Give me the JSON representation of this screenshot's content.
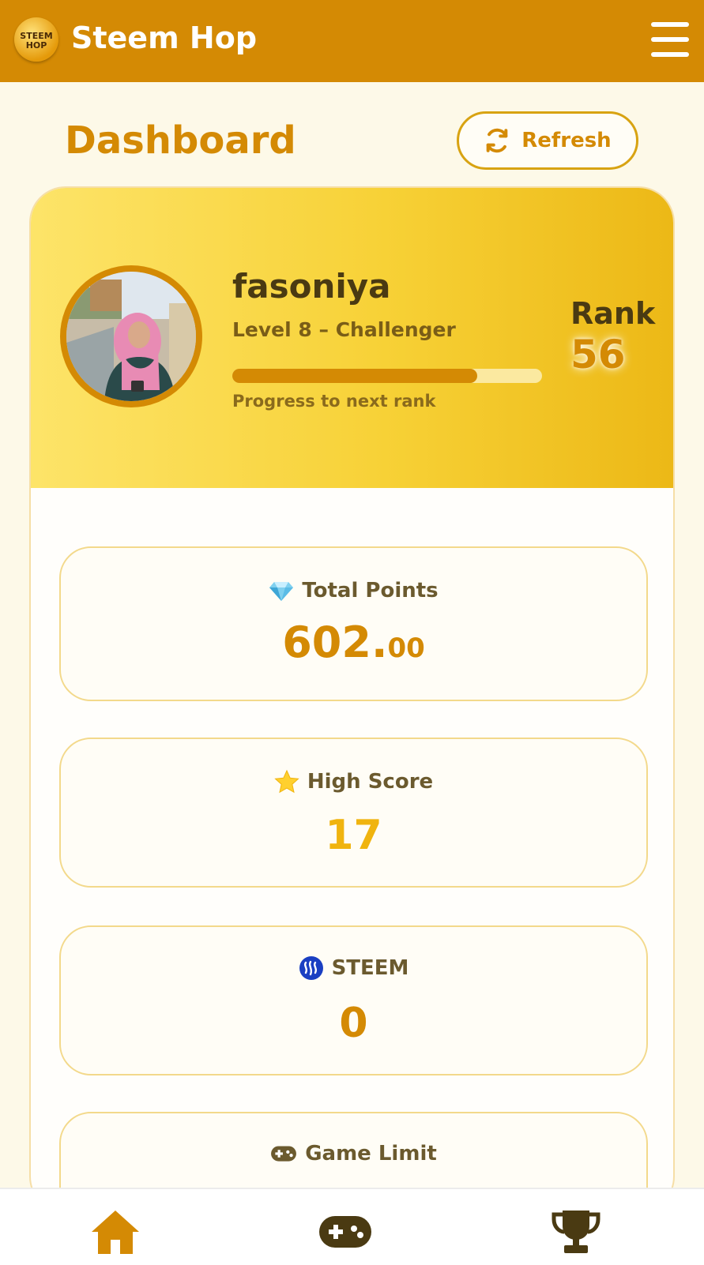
{
  "app": {
    "title": "Steem Hop",
    "logo_line1": "STEEM",
    "logo_line2": "HOP",
    "brand_color": "#d48a04"
  },
  "header": {
    "menu_icon": "hamburger-icon"
  },
  "page": {
    "title": "Dashboard"
  },
  "refresh": {
    "label": "Refresh",
    "icon": "refresh-icon"
  },
  "profile": {
    "username": "fasoniya",
    "level_text": "Level 8 – Challenger",
    "progress_fraction": 0.79,
    "progress_label": "Progress to next rank",
    "rank_label": "Rank",
    "rank_value": "56"
  },
  "stats": {
    "total_points": {
      "icon": "diamond-icon",
      "label": "Total Points",
      "value_int": "602.",
      "value_dec": "00"
    },
    "high_score": {
      "icon": "star-icon",
      "label": "High Score",
      "value": "17"
    },
    "steem": {
      "icon": "steem-logo-icon",
      "label": "STEEM",
      "value": "0"
    },
    "game_limit": {
      "icon": "gamepad-icon",
      "label": "Game Limit"
    }
  },
  "bottom_nav": [
    {
      "name": "home",
      "icon": "home-icon",
      "color": "#d48a04"
    },
    {
      "name": "games",
      "icon": "gamepad-icon",
      "color": "#4a3a12"
    },
    {
      "name": "leaderboard",
      "icon": "trophy-icon",
      "color": "#4a3a12"
    }
  ]
}
